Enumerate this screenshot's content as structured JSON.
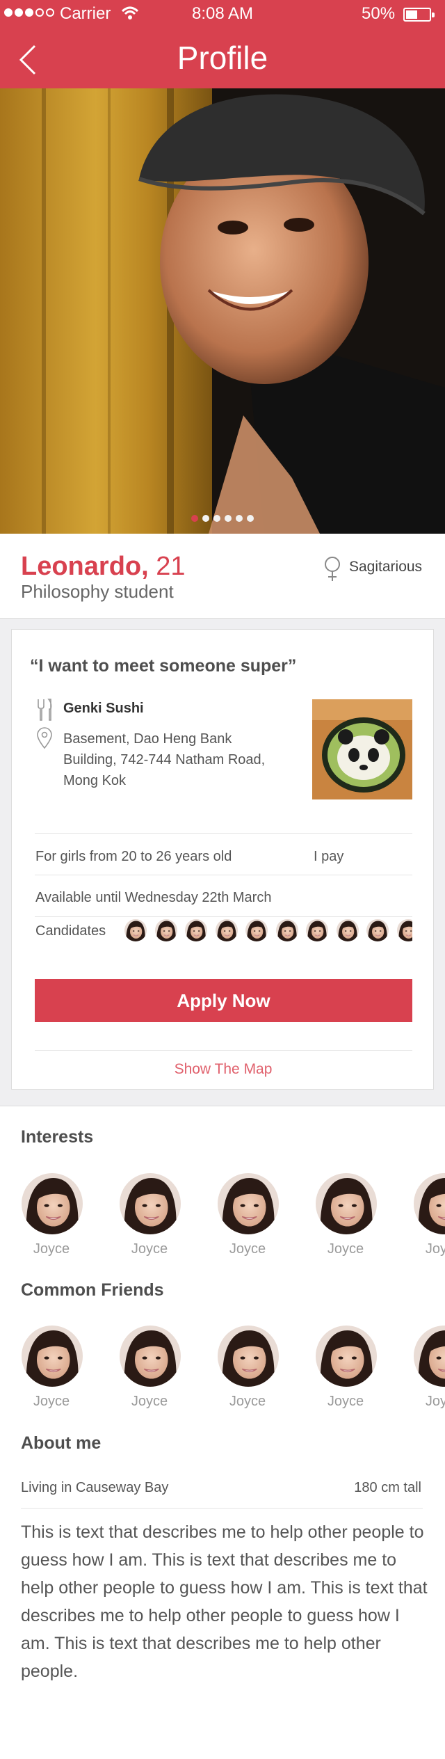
{
  "status_bar": {
    "carrier": "Carrier",
    "time": "8:08 AM",
    "battery": "50%"
  },
  "header": {
    "title": "Profile",
    "back_icon": "chevron-left-icon"
  },
  "photo": {
    "page_count": 6,
    "active_page": 1
  },
  "profile": {
    "name": "Leonardo,",
    "age": "21",
    "occupation": "Philosophy student",
    "zodiac": "Sagitarious",
    "zodiac_icon": "female-symbol-icon"
  },
  "invite": {
    "quote": "“I want to meet someone super”",
    "place_icon": "fork-knife-icon",
    "place_name": "Genki Sushi",
    "address_icon": "map-pin-icon",
    "address": "Basement, Dao Heng Bank Building, 742-744 Natham Road, Mong Kok",
    "target": "For girls from 20 to 26 years old",
    "payment": "I pay",
    "availability": "Available until Wednesday 22th March",
    "candidates_label": "Candidates",
    "candidate_count_visible": 10,
    "apply_label": "Apply Now",
    "map_link": "Show The Map"
  },
  "interests": {
    "title": "Interests",
    "items": [
      {
        "label": "Joyce"
      },
      {
        "label": "Joyce"
      },
      {
        "label": "Joyce"
      },
      {
        "label": "Joyce"
      },
      {
        "label": "Joyce"
      }
    ]
  },
  "common_friends": {
    "title": "Common Friends",
    "items": [
      {
        "label": "Joyce"
      },
      {
        "label": "Joyce"
      },
      {
        "label": "Joyce"
      },
      {
        "label": "Joyce"
      },
      {
        "label": "Joyce"
      }
    ]
  },
  "about": {
    "title": "About me",
    "location": "Living in Causeway Bay",
    "height": "180 cm tall",
    "text": "This is text that describes me to help other people to guess how I am. This is text that describes me to help other people to guess how I am. This is text that describes me to help other people to guess how I am. This is text that describes me to help other people."
  },
  "colors": {
    "accent": "#d8414f",
    "background_band": "#efeff1",
    "link": "#e0606c"
  }
}
